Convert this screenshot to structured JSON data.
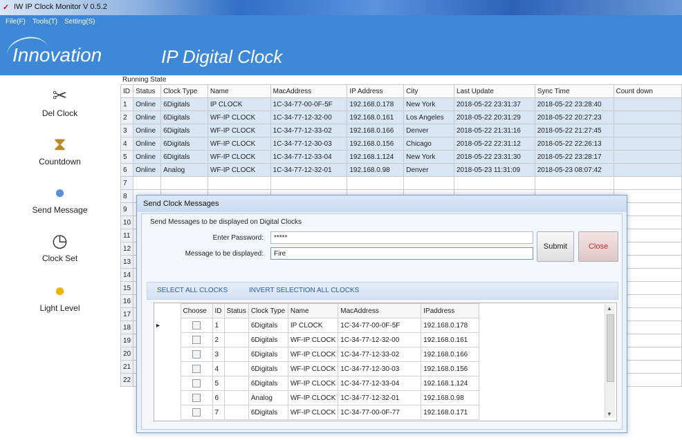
{
  "window": {
    "title": "IW IP Clock Monitor V 0.5.2"
  },
  "menu": [
    "File(F)",
    "Tools(T)",
    "Setting(S)"
  ],
  "banner": {
    "brand": "nnovation",
    "brand_initial": "I",
    "product": "IP Digital Clock"
  },
  "sidebar": {
    "items": [
      {
        "label": "Del Clock",
        "icon": "scissors-icon"
      },
      {
        "label": "Countdown",
        "icon": "hourglass-icon"
      },
      {
        "label": "Send Message",
        "icon": "globe-icon"
      },
      {
        "label": "Clock Set",
        "icon": "clock-icon"
      },
      {
        "label": "Light Level",
        "icon": "lightbulb-icon"
      }
    ]
  },
  "running_state": {
    "label": "Running State",
    "columns": [
      "ID",
      "Status",
      "Clock Type",
      "Name",
      "MacAddress",
      "IP Address",
      "City",
      "Last Update",
      "Sync Time",
      "Count down"
    ],
    "rows": [
      [
        "1",
        "Online",
        "6Digitals",
        "IP CLOCK",
        "1C-34-77-00-0F-5F",
        "192.168.0.178",
        "New York",
        "2018-05-22 23:31:37",
        "2018-05-22 23:28:40",
        ""
      ],
      [
        "2",
        "Online",
        "6Digitals",
        "WF-IP CLOCK",
        "1C-34-77-12-32-00",
        "192.168.0.161",
        "Los Angeles",
        "2018-05-22 20:31:29",
        "2018-05-22 20:27:23",
        ""
      ],
      [
        "3",
        "Online",
        "6Digitals",
        "WF-IP CLOCK",
        "1C-34-77-12-33-02",
        "192.168.0.166",
        "Denver",
        "2018-05-22 21:31:16",
        "2018-05-22 21:27:45",
        ""
      ],
      [
        "4",
        "Online",
        "6Digitals",
        "WF-IP CLOCK",
        "1C-34-77-12-30-03",
        "192.168.0.156",
        "Chicago",
        "2018-05-22 22:31:12",
        "2018-05-22 22:26:13",
        ""
      ],
      [
        "5",
        "Online",
        "6Digitals",
        "WF-IP CLOCK",
        "1C-34-77-12-33-04",
        "192.168.1.124",
        "New York",
        "2018-05-22 23:31:30",
        "2018-05-22 23:28:17",
        ""
      ],
      [
        "6",
        "Online",
        "Analog",
        "WF-IP CLOCK",
        "1C-34-77-12-32-01",
        "192.168.0.98",
        "Denver",
        "2018-05-23 11:31:09",
        "2018-05-23 08:07:42",
        ""
      ]
    ],
    "extra_ids": [
      "7",
      "8",
      "9",
      "10",
      "11",
      "12",
      "13",
      "14",
      "15",
      "16",
      "17",
      "18",
      "19",
      "20",
      "21",
      "22"
    ]
  },
  "dialog": {
    "title": "Send Clock Messages",
    "group_label": "Send Messages to be displayed on Digital Clocks",
    "password_label": "Enter Password:",
    "password_value": "*****",
    "message_label": "Message to be displayed:",
    "message_value": "Fire",
    "submit": "Submit",
    "close": "Close",
    "select_all": "SELECT ALL CLOCKS",
    "invert": "INVERT SELECTION ALL CLOCKS",
    "columns": [
      "Choose",
      "ID",
      "Status",
      "Clock Type",
      "Name",
      "MacAddress",
      "IPaddress"
    ],
    "rows": [
      [
        "1",
        "",
        "6Digitals",
        "IP CLOCK",
        "1C-34-77-00-0F-5F",
        "192.168.0.178"
      ],
      [
        "2",
        "",
        "6Digitals",
        "WF-IP CLOCK",
        "1C-34-77-12-32-00",
        "192.168.0.161"
      ],
      [
        "3",
        "",
        "6Digitals",
        "WF-IP CLOCK",
        "1C-34-77-12-33-02",
        "192.168.0.166"
      ],
      [
        "4",
        "",
        "6Digitals",
        "WF-IP CLOCK",
        "1C-34-77-12-30-03",
        "192.168.0.156"
      ],
      [
        "5",
        "",
        "6Digitals",
        "WF-IP CLOCK",
        "1C-34-77-12-33-04",
        "192.168.1.124"
      ],
      [
        "6",
        "",
        "Analog",
        "WF-IP CLOCK",
        "1C-34-77-12-32-01",
        "192.168.0.98"
      ],
      [
        "7",
        "",
        "6Digitals",
        "WF-IP CLOCK",
        "1C-34-77-00-0F-77",
        "192.168.0.171"
      ]
    ]
  }
}
